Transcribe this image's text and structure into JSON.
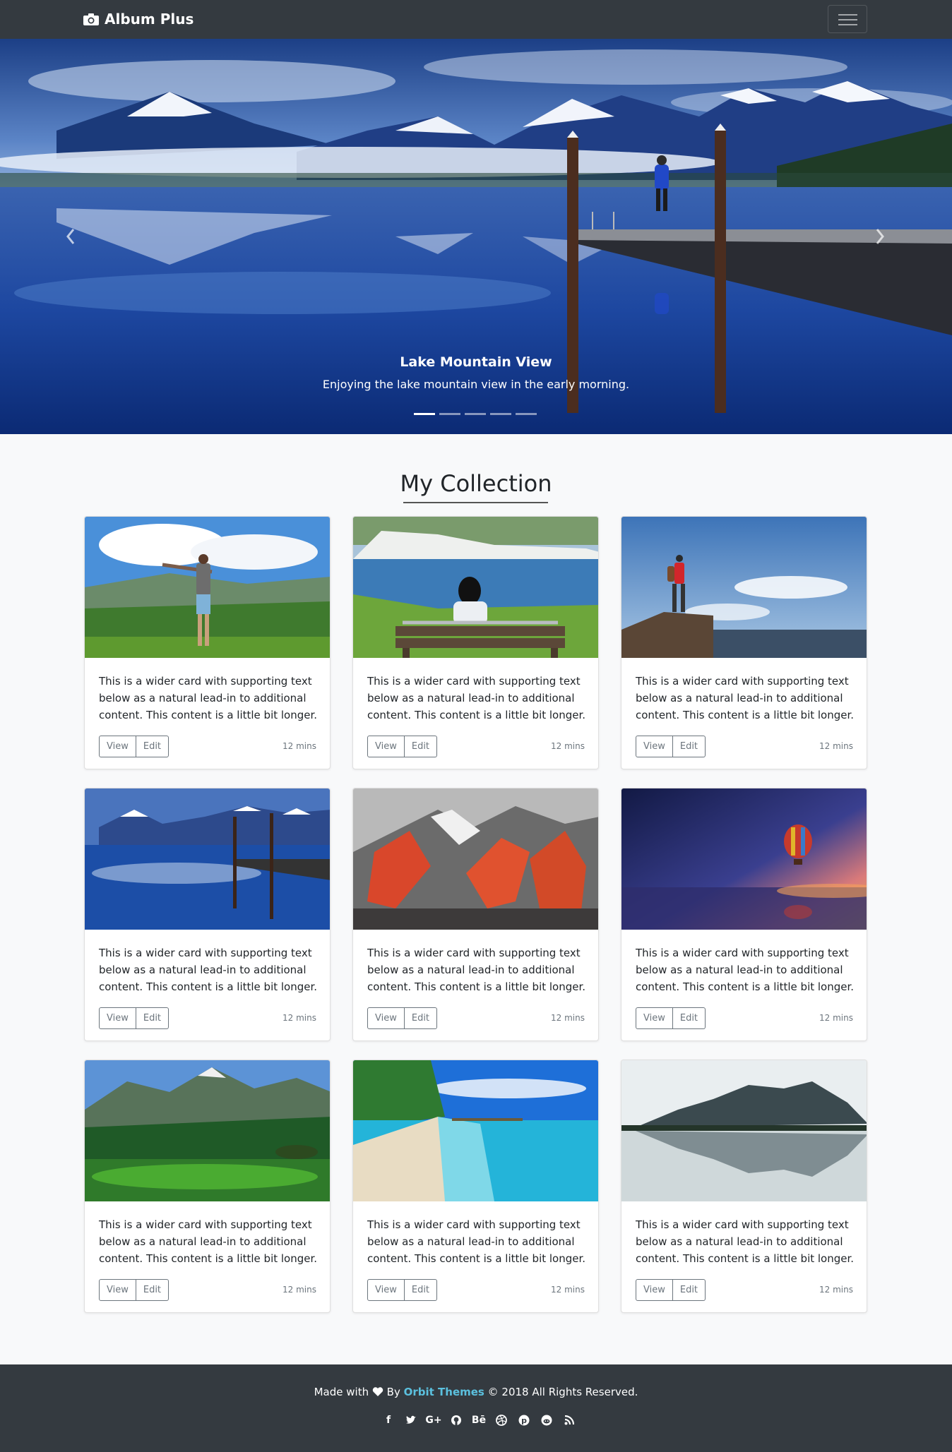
{
  "navbar": {
    "brand": "Album Plus"
  },
  "carousel": {
    "active_index": 0,
    "slide_count": 5,
    "caption_title": "Lake Mountain View",
    "caption_text": "Enjoying the lake mountain view in the early morning."
  },
  "collection": {
    "title": "My Collection",
    "cards": [
      {
        "scene": "man-arms-outstretched-valley",
        "text": "This is a wider card with supporting text below as a natural lead-in to additional content. This content is a little bit longer.",
        "view_label": "View",
        "edit_label": "Edit",
        "time": "12 mins"
      },
      {
        "scene": "woman-bench-white-cliffs",
        "text": "This is a wider card with supporting text below as a natural lead-in to additional content. This content is a little bit longer.",
        "view_label": "View",
        "edit_label": "Edit",
        "time": "12 mins"
      },
      {
        "scene": "hiker-on-rock-ledge",
        "text": "This is a wider card with supporting text below as a natural lead-in to additional content. This content is a little bit longer.",
        "view_label": "View",
        "edit_label": "Edit",
        "time": "12 mins"
      },
      {
        "scene": "lake-mountain-dock",
        "text": "This is a wider card with supporting text below as a natural lead-in to additional content. This content is a little bit longer.",
        "view_label": "View",
        "edit_label": "Edit",
        "time": "12 mins"
      },
      {
        "scene": "red-rock-snowy-peaks",
        "text": "This is a wider card with supporting text below as a natural lead-in to additional content. This content is a little bit longer.",
        "view_label": "View",
        "edit_label": "Edit",
        "time": "12 mins"
      },
      {
        "scene": "hot-air-balloon-sunset",
        "text": "This is a wider card with supporting text below as a natural lead-in to additional content. This content is a little bit longer.",
        "view_label": "View",
        "edit_label": "Edit",
        "time": "12 mins"
      },
      {
        "scene": "green-lake-forest-mountains",
        "text": "This is a wider card with supporting text below as a natural lead-in to additional content. This content is a little bit longer.",
        "view_label": "View",
        "edit_label": "Edit",
        "time": "12 mins"
      },
      {
        "scene": "tropical-beach-turquoise",
        "text": "This is a wider card with supporting text below as a natural lead-in to additional content. This content is a little bit longer.",
        "view_label": "View",
        "edit_label": "Edit",
        "time": "12 mins"
      },
      {
        "scene": "misty-mountain-reflection",
        "text": "This is a wider card with supporting text below as a natural lead-in to additional content. This content is a little bit longer.",
        "view_label": "View",
        "edit_label": "Edit",
        "time": "12 mins"
      }
    ]
  },
  "footer": {
    "made_with": "Made with",
    "by": "By",
    "company": "Orbit Themes",
    "rights": "© 2018 All Rights Reserved.",
    "social_icons": [
      "facebook-icon",
      "twitter-icon",
      "google-plus-icon",
      "github-icon",
      "behance-icon",
      "dribbble-icon",
      "pinterest-icon",
      "reddit-icon",
      "rss-icon"
    ],
    "accent_color": "#5bc0de",
    "background_color": "#343a40"
  }
}
